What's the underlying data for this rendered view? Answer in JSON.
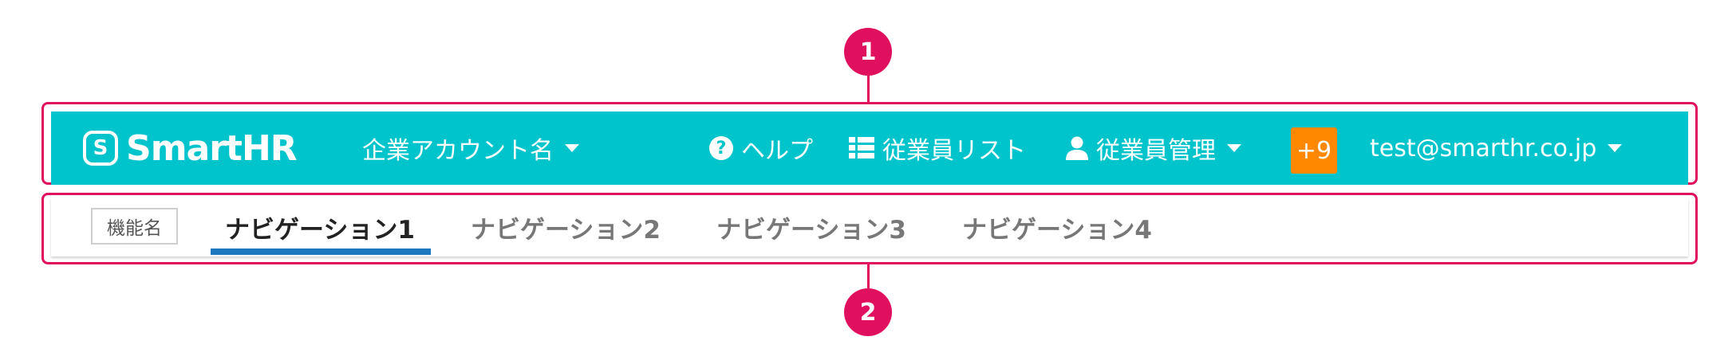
{
  "annotations": {
    "marker_1": "1",
    "marker_2": "2"
  },
  "header": {
    "logo_text": "SmartHR",
    "logo_mark": "S",
    "account_name": "企業アカウント名",
    "help_label": "ヘルプ",
    "employee_list_label": "従業員リスト",
    "employee_manage_label": "従業員管理",
    "notification_badge": "+9",
    "user_email": "test@smarthr.co.jp",
    "background_color": "#00c4cc",
    "badge_color": "#ff8800"
  },
  "nav": {
    "feature_name": "機能名",
    "tabs": [
      {
        "label": "ナビゲーション1",
        "active": true
      },
      {
        "label": "ナビゲーション2",
        "active": false
      },
      {
        "label": "ナビゲーション3",
        "active": false
      },
      {
        "label": "ナビゲーション4",
        "active": false
      }
    ],
    "active_color": "#1e78c0"
  },
  "icons": {
    "help": "question-circle-icon",
    "list": "list-icon",
    "user": "user-icon",
    "caret": "caret-down-icon"
  },
  "accent_color": "#e0105e"
}
